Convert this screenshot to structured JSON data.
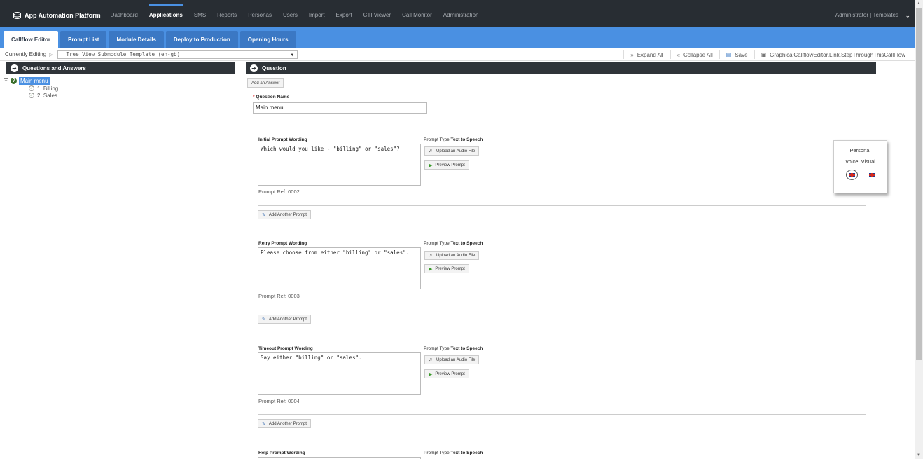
{
  "topnav": {
    "brand": "App Automation Platform",
    "brand_icon": "database-icon",
    "items": [
      "Dashboard",
      "Applications",
      "SMS",
      "Reports",
      "Personas",
      "Users",
      "Import",
      "Export",
      "CTI Viewer",
      "Call Monitor",
      "Administration"
    ],
    "active": "Applications",
    "user": "Administrator [ Templates ]",
    "accent": "#4a90e2"
  },
  "tabs": [
    "Callflow Editor",
    "Prompt List",
    "Module Details",
    "Deploy to Production",
    "Opening Hours"
  ],
  "editbar": {
    "label": "Currently Editing",
    "selected": "Tree View Submodule Template (en-gb)",
    "expand_all": "Expand All",
    "collapse_all": "Collapse All",
    "save": "Save",
    "step_through": "GraphicalCallflowEditor.Link.StepThroughThisCallFlow"
  },
  "left": {
    "header": "Questions and Answers",
    "root": "Main menu",
    "children": [
      "1. Billing",
      "2. Sales"
    ]
  },
  "right": {
    "header": "Question",
    "add_answer": "Add an Answer",
    "question_name_label": "Question Name",
    "question_name_value": "Main menu",
    "prompt_type_label": "Prompt Type:",
    "prompt_type_value": "Text to Speech",
    "upload_label": "Upload an Audio File",
    "preview_label": "Preview Prompt",
    "add_another_label": "Add Another Prompt",
    "sections": [
      {
        "title": "Initial Prompt Wording",
        "text": "Which would you like - \"billing\" or \"sales\"?",
        "ref": "Prompt Ref: 0002"
      },
      {
        "title": "Retry Prompt Wording",
        "text": "Please choose from either \"billing\" or \"sales\".",
        "ref": "Prompt Ref: 0003"
      },
      {
        "title": "Timeout Prompt Wording",
        "text": "Say either \"billing\" or \"sales\".",
        "ref": "Prompt Ref: 0004"
      },
      {
        "title": "Help Prompt Wording",
        "text": "",
        "ref": ""
      }
    ]
  },
  "persona": {
    "title": "Persona:",
    "voice": "Voice",
    "visual": "Visual"
  }
}
